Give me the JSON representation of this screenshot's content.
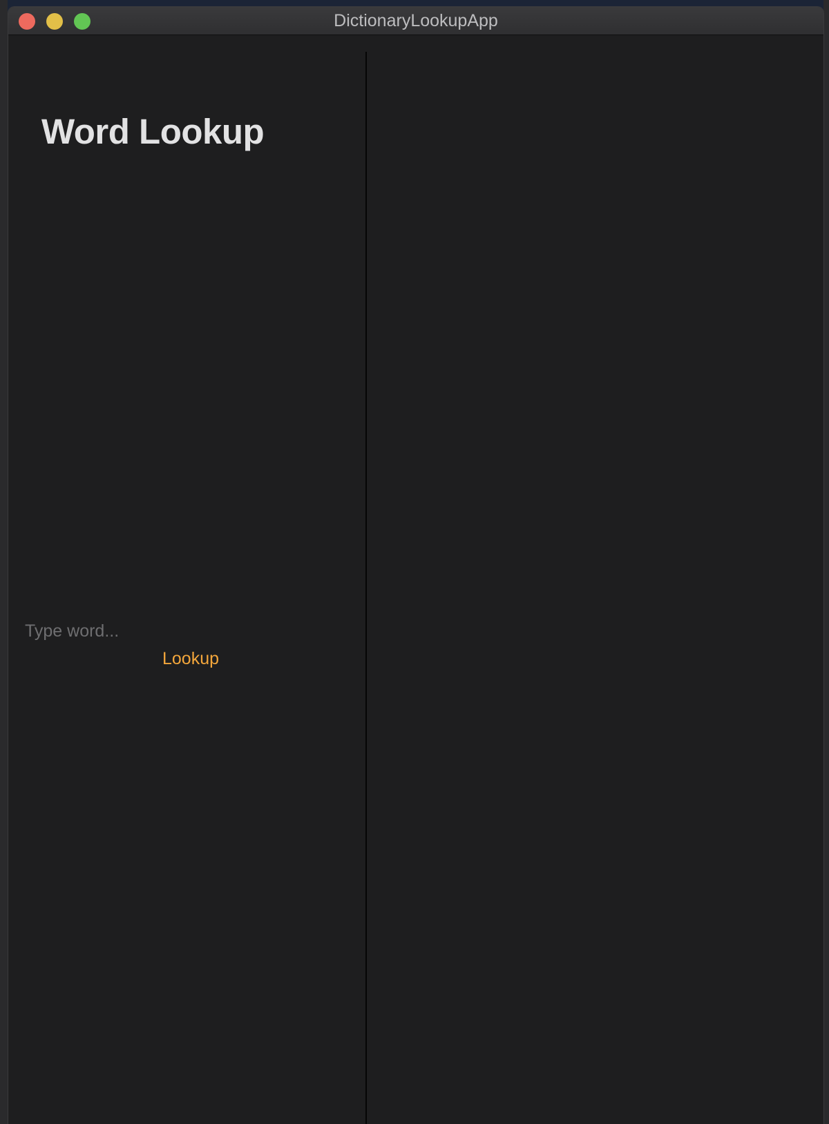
{
  "window": {
    "title": "DictionaryLookupApp"
  },
  "sidebar": {
    "heading": "Word Lookup",
    "word_input": {
      "value": "",
      "placeholder": "Type word..."
    },
    "lookup_button_label": "Lookup"
  },
  "colors": {
    "accent": "#f3a63b",
    "window_background": "#1e1e1f",
    "close_button": "#ee6a5e",
    "minimize_button": "#e2bf48",
    "zoom_button": "#62c554"
  }
}
